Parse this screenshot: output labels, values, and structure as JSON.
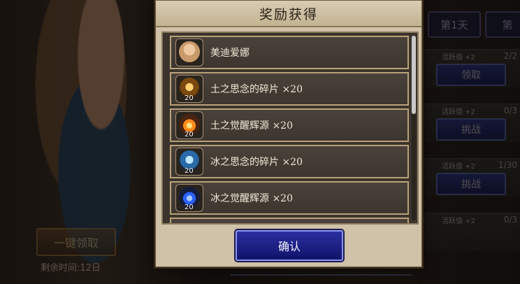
{
  "background": {
    "claim_all_button": "一键领取",
    "remaining_time": "剩余时间:12日",
    "day_tabs": [
      "第1天",
      "第"
    ],
    "tasks": [
      {
        "activity": "活跃值 +2",
        "progress": "2/2",
        "button": "领取"
      },
      {
        "activity": "活跃值 +2",
        "progress": "0/3",
        "button": "挑战"
      },
      {
        "activity": "活跃值 +2",
        "progress": "1/30",
        "button": "挑战"
      },
      {
        "activity": "活跃值 +2",
        "progress": "0/3",
        "button": ""
      }
    ]
  },
  "modal": {
    "title": "奖励获得",
    "items": [
      {
        "name": "美迪爱娜",
        "quantity": "",
        "icon": "character-portrait-icon",
        "color": "#c89a6a"
      },
      {
        "name": "土之思念的碎片 ×20",
        "quantity": "20",
        "icon": "earth-shard-icon",
        "color": "#d89a30"
      },
      {
        "name": "土之觉醒辉源 ×20",
        "quantity": "20",
        "icon": "earth-flame-icon",
        "color": "#ff8a1a"
      },
      {
        "name": "冰之思念的碎片 ×20",
        "quantity": "20",
        "icon": "ice-shard-icon",
        "color": "#4aa0e8"
      },
      {
        "name": "冰之觉醒辉源 ×20",
        "quantity": "20",
        "icon": "ice-flame-icon",
        "color": "#2a62ff"
      }
    ],
    "confirm_label": "确认"
  },
  "colors": {
    "modal_bg": "#cfc2a8",
    "item_border": "#b9a27a",
    "confirm_bg": "#141c68"
  }
}
